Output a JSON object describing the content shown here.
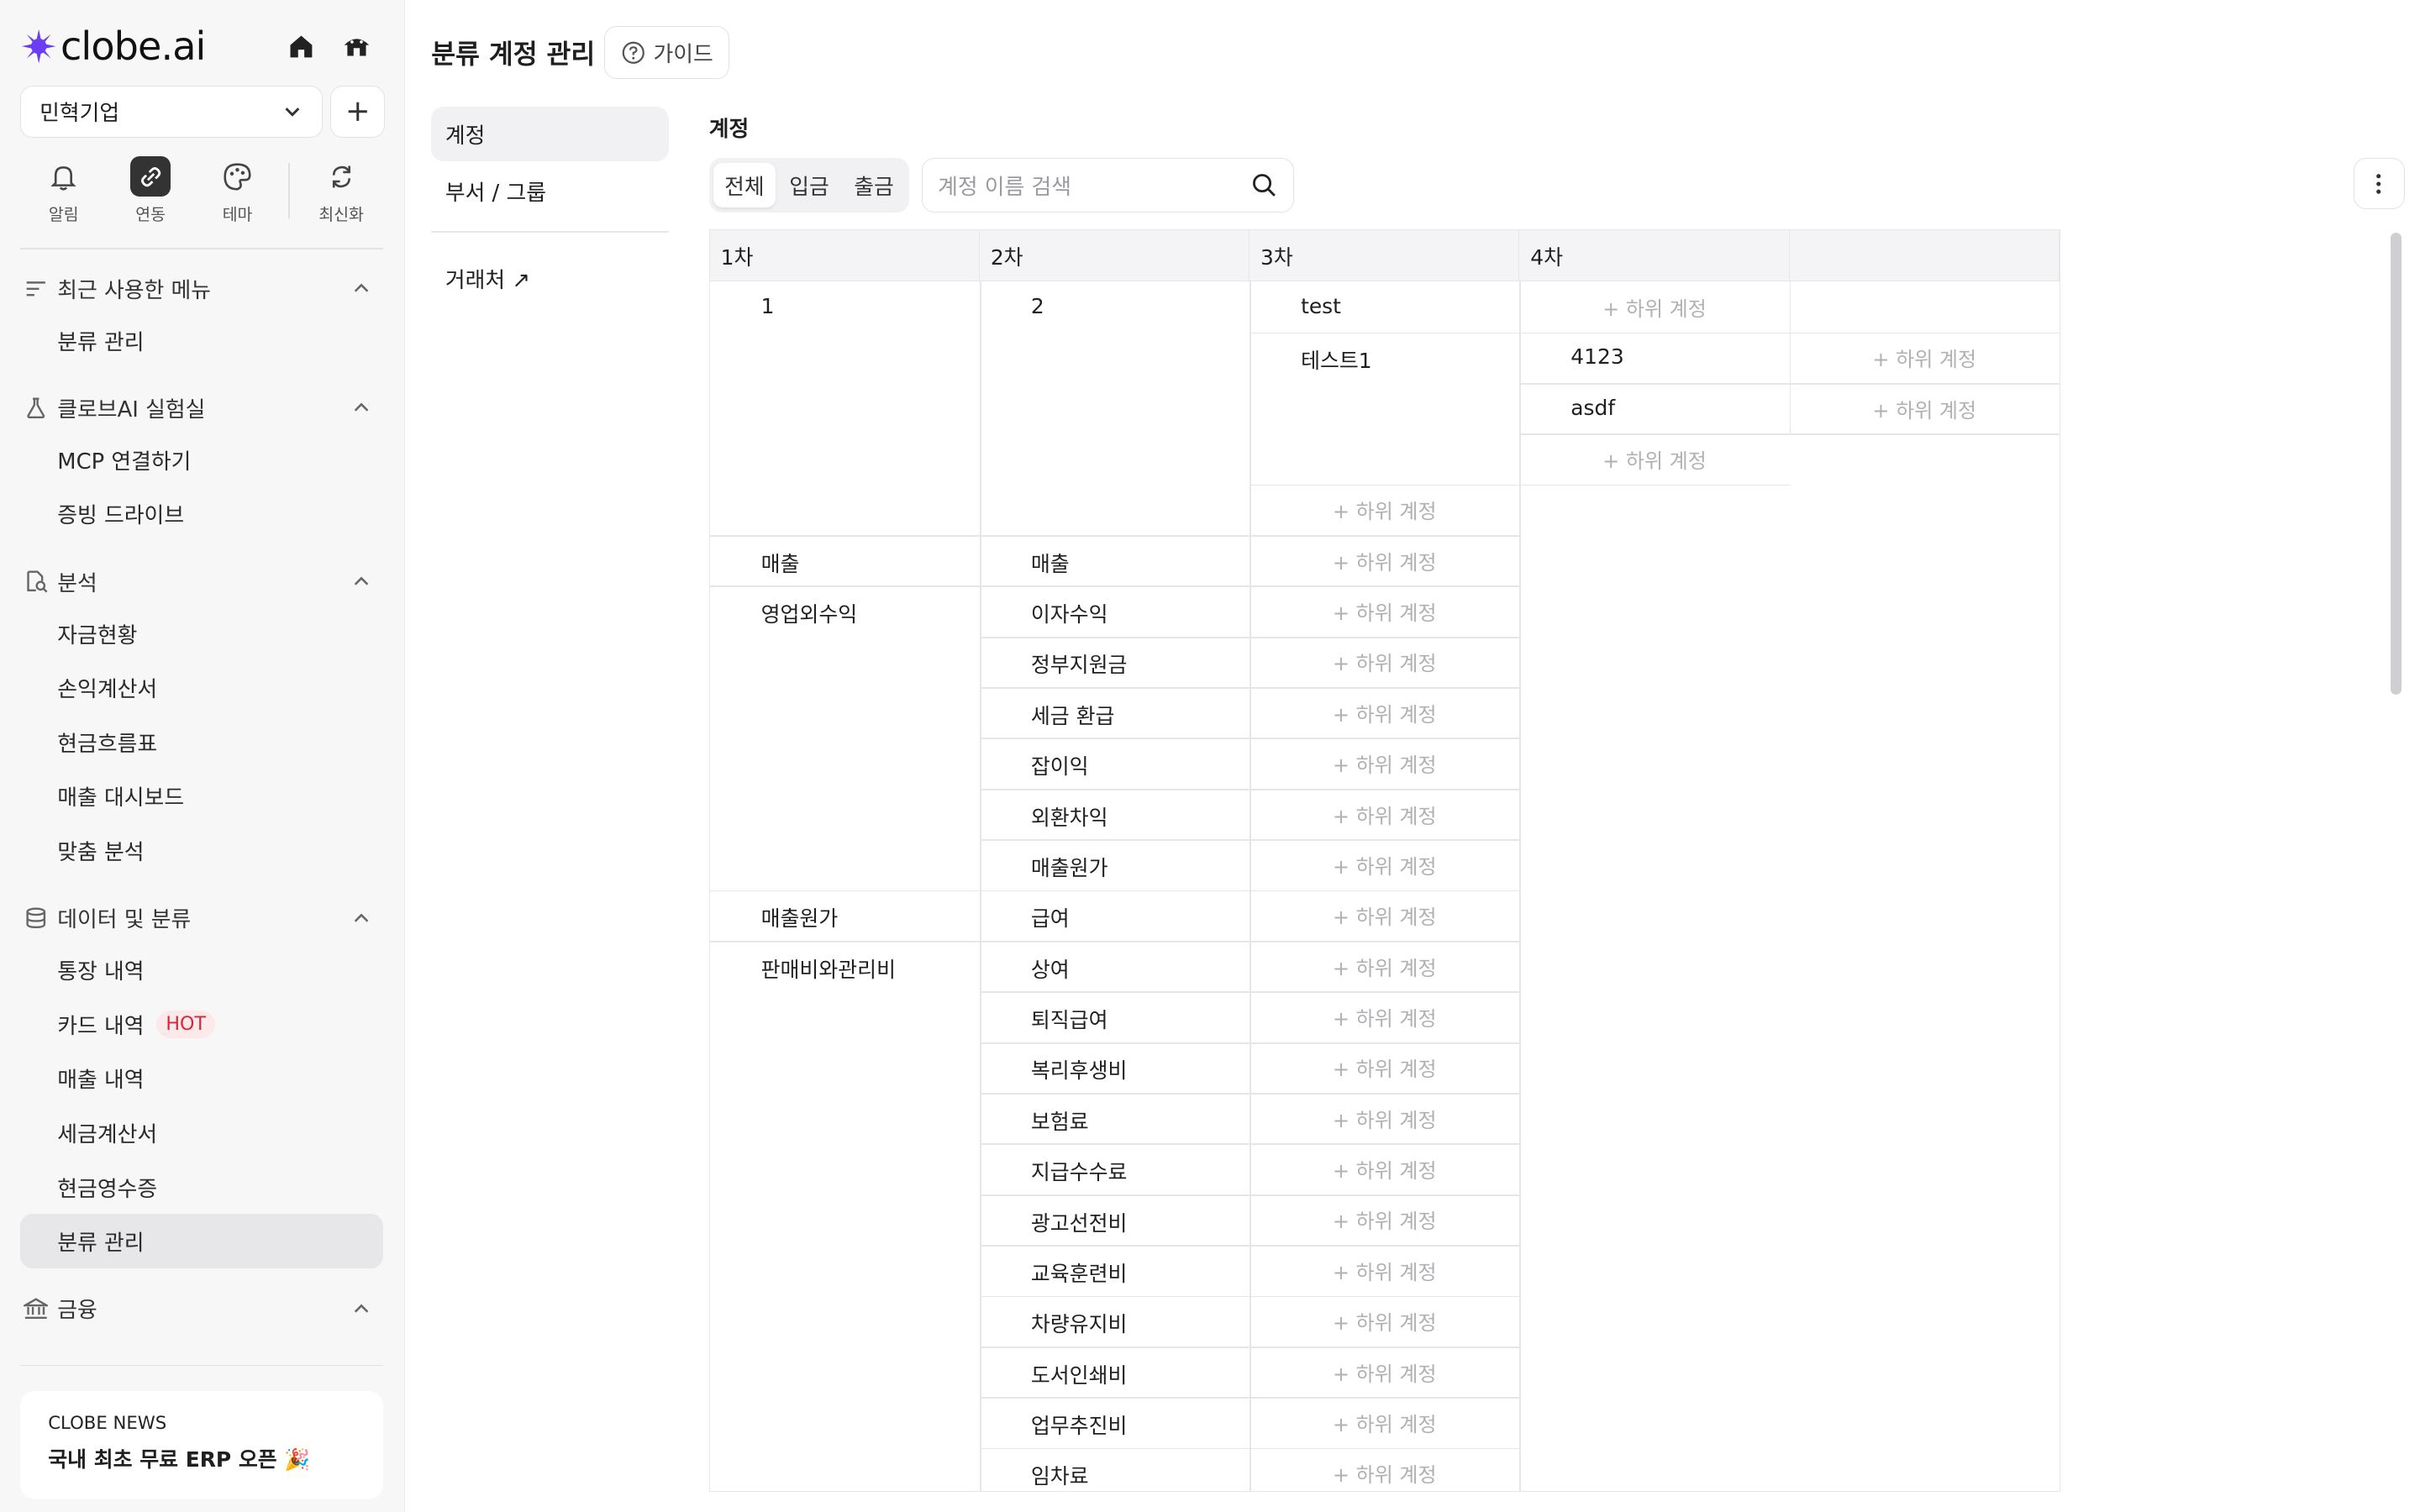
{
  "brand": {
    "name": "clobe.ai"
  },
  "org": {
    "selected": "민혁기업"
  },
  "quick": [
    {
      "label": "알림",
      "icon": "bell-icon"
    },
    {
      "label": "연동",
      "icon": "link-icon"
    },
    {
      "label": "테마",
      "icon": "palette-icon"
    },
    {
      "label": "최신화",
      "icon": "refresh-icon"
    }
  ],
  "nav": {
    "recent": {
      "title": "최근 사용한 메뉴",
      "items": [
        "분류 관리"
      ]
    },
    "lab": {
      "title": "클로브AI 실험실",
      "items": [
        "MCP 연결하기",
        "증빙 드라이브"
      ]
    },
    "analysis": {
      "title": "분석",
      "items": [
        "자금현황",
        "손익계산서",
        "현금흐름표",
        "매출 대시보드",
        "맞춤 분석"
      ]
    },
    "data": {
      "title": "데이터 및 분류",
      "items": [
        "통장 내역",
        "카드 내역",
        "매출 내역",
        "세금계산서",
        "현금영수증",
        "분류 관리"
      ],
      "hot_badge": "HOT"
    },
    "finance": {
      "title": "금융"
    }
  },
  "news": {
    "label": "CLOBE NEWS",
    "headline": "국내 최초 무료 ERP 오픈 🎉"
  },
  "page": {
    "title": "분류 계정 관리",
    "guide": "가이드"
  },
  "subnav": {
    "items": [
      "계정",
      "부서 / 그룹",
      "거래처 ↗"
    ]
  },
  "section": {
    "label": "계정"
  },
  "filters": {
    "options": [
      "전체",
      "입금",
      "출금"
    ],
    "selected": "전체"
  },
  "search": {
    "placeholder": "계정 이름 검색"
  },
  "grid": {
    "headers": [
      "1차",
      "2차",
      "3차",
      "4차",
      ""
    ],
    "add_label": "+ 하위 계정",
    "level1": [
      "1",
      "매출",
      "영업외수익",
      "매출원가",
      "판매비와관리비"
    ],
    "level2": [
      "2",
      "매출",
      "이자수익",
      "정부지원금",
      "세금 환급",
      "잡이익",
      "외환차익",
      "매출원가",
      "급여",
      "상여",
      "퇴직급여",
      "복리후생비",
      "보험료",
      "지급수수료",
      "광고선전비",
      "교육훈련비",
      "차량유지비",
      "도서인쇄비",
      "업무추진비",
      "임차료"
    ],
    "level3": [
      "test",
      "테스트1"
    ],
    "level4": [
      "4123",
      "asdf"
    ]
  }
}
